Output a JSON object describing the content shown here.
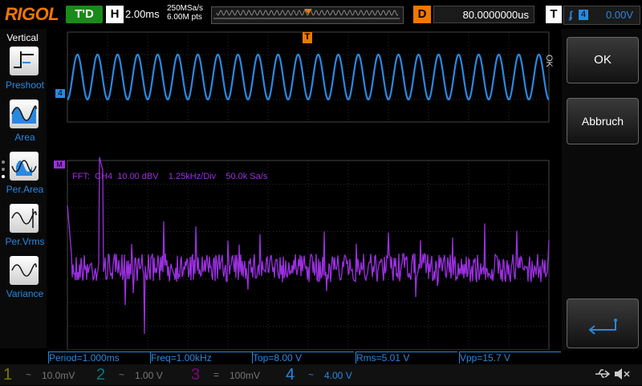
{
  "header": {
    "logo": "RIGOL",
    "run_state": "T'D",
    "h_label": "H",
    "timebase": "2.00ms",
    "sample_rate": "250MSa/s",
    "mem_depth": "6.00M pts",
    "delay_label": "D",
    "delay_value": "80.0000000us",
    "trig_label": "T",
    "trig_channel": "4",
    "trig_level": "0.00V"
  },
  "menu": {
    "title": "Vertical",
    "items": [
      {
        "label": "Preshoot",
        "icon": "preshoot-icon"
      },
      {
        "label": "Area",
        "icon": "area-icon"
      },
      {
        "label": "Per.Area",
        "icon": "per-area-icon"
      },
      {
        "label": "Per.Vrms",
        "icon": "per-vrms-icon"
      },
      {
        "label": "Variance",
        "icon": "variance-icon"
      }
    ]
  },
  "screen": {
    "ch4_marker": "4",
    "math_marker": "M",
    "fft_info": "FFT:  CH4  10.00 dBV    1.25kHz/Div    50.0k Sa/s",
    "trigger_marker": "T"
  },
  "right_menu": {
    "ok_side": "OK",
    "ok_label": "OK",
    "cancel_label": "Abbruch"
  },
  "measurements": [
    {
      "label": "Period=1.000ms"
    },
    {
      "label": "Freq=1.00kHz"
    },
    {
      "label": "Top=8.00 V"
    },
    {
      "label": "Rms=5.01 V"
    },
    {
      "label": "Vpp=15.7 V"
    }
  ],
  "channels": [
    {
      "num": "1",
      "coupling": "~",
      "scale": "10.0mV",
      "color": "#d6c600"
    },
    {
      "num": "2",
      "coupling": "~",
      "scale": "1.00 V",
      "color": "#00c8d6"
    },
    {
      "num": "3",
      "coupling": "=",
      "scale": "100mV",
      "color": "#d000d0"
    },
    {
      "num": "4",
      "coupling": "~",
      "scale": "4.00 V",
      "color": "#2a88e0"
    }
  ],
  "colors": {
    "ch4": "#2a88e0",
    "math": "#9a30e0",
    "trigger": "#f07800"
  },
  "status_icons": [
    "usb-icon",
    "sound-muted-icon"
  ]
}
